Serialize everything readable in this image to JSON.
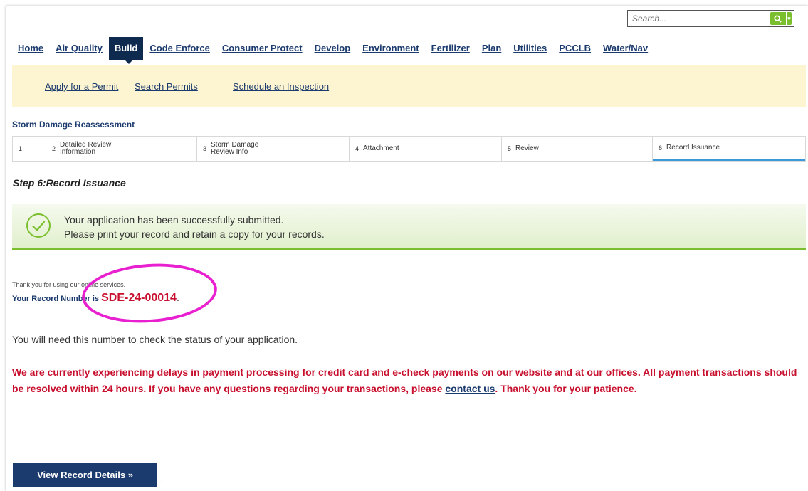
{
  "search": {
    "placeholder": "Search..."
  },
  "nav": {
    "items": [
      "Home",
      "Air Quality",
      "Build",
      "Code Enforce",
      "Consumer Protect",
      "Develop",
      "Environment",
      "Fertilizer",
      "Plan",
      "Utilities",
      "PCCLB",
      "Water/Nav"
    ],
    "active": "Build"
  },
  "subnav": {
    "items": [
      "Apply for a Permit",
      "Search Permits",
      "Schedule an Inspection"
    ]
  },
  "section_title": "Storm Damage Reassessment",
  "steps": [
    {
      "num": "1",
      "label": ""
    },
    {
      "num": "2",
      "label": "Detailed Review Information"
    },
    {
      "num": "3",
      "label": "Storm Damage Review Info"
    },
    {
      "num": "4",
      "label": "Attachment"
    },
    {
      "num": "5",
      "label": "Review"
    },
    {
      "num": "6",
      "label": "Record Issuance"
    }
  ],
  "step_heading": "Step 6:Record Issuance",
  "success": {
    "line1": "Your application has been successfully submitted.",
    "line2": "Please print your record and retain a copy for your records."
  },
  "thanks": "Thank you for using our online services.",
  "record": {
    "prefix": "Your Record Number is",
    "number": "SDE-24-00014",
    "suffix": "."
  },
  "need_text": "You will need this number to check the status of your application.",
  "alert": {
    "part1": "We are currently experiencing delays in payment processing for credit card and e-check payments on our website and at our offices.  All payment transactions should be resolved within 24 hours. If you have any questions regarding your transactions, please",
    "link": "contact us",
    "part2": ".  Thank you for your patience."
  },
  "button": {
    "view_label": "View Record Details »"
  },
  "trailing_dot": ".",
  "colors": {
    "navy": "#1b3a6e",
    "active_tab": "#0f2a4f",
    "green": "#7bbf2e",
    "red": "#c8102e",
    "subnav_bg": "#fdf5d2",
    "annotation": "#e820d0"
  }
}
